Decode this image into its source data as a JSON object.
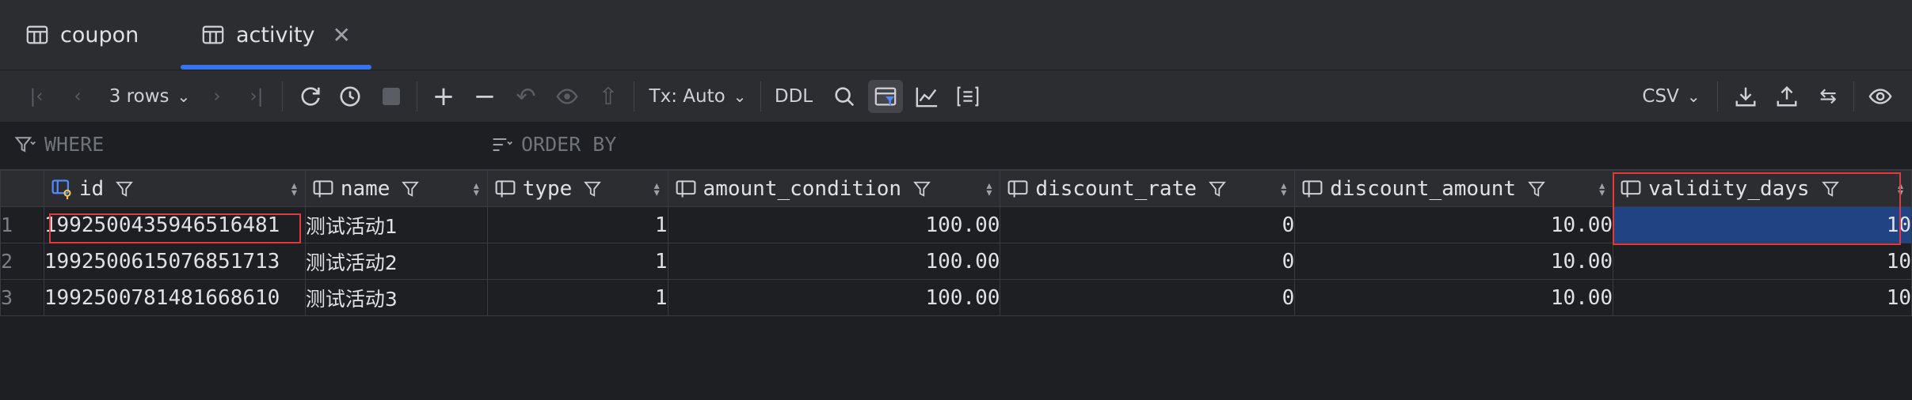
{
  "tabs": [
    {
      "label": "coupon",
      "active": false
    },
    {
      "label": "activity",
      "active": true,
      "closable": true
    }
  ],
  "toolbar": {
    "rows_label": "3 rows",
    "tx_label": "Tx: Auto",
    "ddl_label": "DDL",
    "export_format": "CSV"
  },
  "filter": {
    "where_label": "WHERE",
    "orderby_label": "ORDER BY"
  },
  "table": {
    "columns": [
      {
        "name": "id"
      },
      {
        "name": "name"
      },
      {
        "name": "type"
      },
      {
        "name": "amount_condition"
      },
      {
        "name": "discount_rate"
      },
      {
        "name": "discount_amount"
      },
      {
        "name": "validity_days"
      }
    ],
    "rows": [
      {
        "num": "1",
        "cells": [
          "1992500435946516481",
          "测试活动1",
          "1",
          "100.00",
          "0",
          "10.00",
          "10"
        ]
      },
      {
        "num": "2",
        "cells": [
          "1992500615076851713",
          "测试活动2",
          "1",
          "100.00",
          "0",
          "10.00",
          "10"
        ]
      },
      {
        "num": "3",
        "cells": [
          "1992500781481668610",
          "测试活动3",
          "1",
          "100.00",
          "0",
          "10.00",
          "10"
        ]
      }
    ],
    "selected_cell": "validity_days row 1"
  },
  "colors": {
    "accent": "#3574f0",
    "selection": "#214283",
    "highlight_box": "#e5383b"
  }
}
